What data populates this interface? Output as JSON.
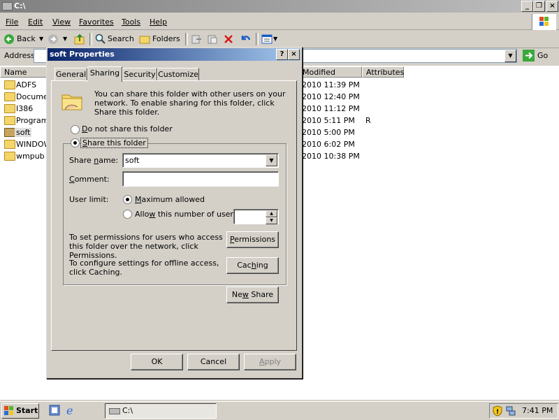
{
  "window": {
    "title": "C:\\",
    "minimize": "_",
    "restore": "❐",
    "close": "×"
  },
  "menu": [
    "File",
    "Edit",
    "View",
    "Favorites",
    "Tools",
    "Help"
  ],
  "toolbar": {
    "back": "Back",
    "search": "Search",
    "folders": "Folders"
  },
  "address": {
    "label": "Address",
    "value": "",
    "go": "Go"
  },
  "columns": {
    "name": "Name",
    "modified": "Modified",
    "attributes": "Attributes"
  },
  "files": [
    {
      "name": "ADFS",
      "modified": "2010 11:39 PM",
      "attr": ""
    },
    {
      "name": "Documen",
      "modified": "2010 12:40 PM",
      "attr": ""
    },
    {
      "name": "I386",
      "modified": "2010 11:12 PM",
      "attr": ""
    },
    {
      "name": "Program",
      "modified": "2010 5:11 PM",
      "attr": "R"
    },
    {
      "name": "soft",
      "modified": "2010 5:00 PM",
      "attr": ""
    },
    {
      "name": "WINDOW",
      "modified": "2010 6:02 PM",
      "attr": ""
    },
    {
      "name": "wmpub",
      "modified": "2010 10:38 PM",
      "attr": ""
    }
  ],
  "dialog": {
    "title": "soft Properties",
    "help": "?",
    "close": "×",
    "tabs": [
      "General",
      "Sharing",
      "Security",
      "Customize"
    ],
    "intro": "You can share this folder with other users on your network.  To enable sharing for this folder, click Share this folder.",
    "do_not_share": "Do not share this folder",
    "share_this": "Share this folder",
    "share_name_label": "Share name:",
    "share_name_value": "soft",
    "comment_label": "Comment:",
    "comment_value": "",
    "user_limit_label": "User limit:",
    "max_allowed": "Maximum allowed",
    "allow_number": "Allow this number of users:",
    "permissions_text": "To set permissions for users who access this folder over the network, click Permissions.",
    "permissions_btn": "Permissions",
    "caching_text": "To configure settings for offline access, click Caching.",
    "caching_btn": "Caching",
    "new_share_btn": "New Share",
    "ok": "OK",
    "cancel": "Cancel",
    "apply": "Apply"
  },
  "taskbar": {
    "start": "Start",
    "task": "C:\\",
    "clock": "7:41 PM"
  }
}
